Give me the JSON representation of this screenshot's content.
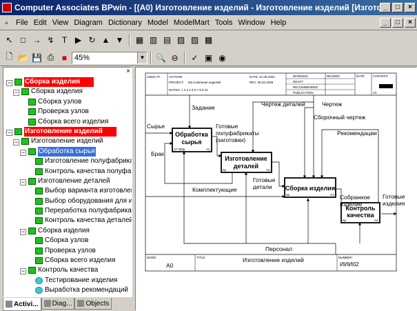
{
  "window": {
    "title": "Computer Associates BPwin - [(A0) Изготовление изделий - Изготовление изделий  [Изготовление изделий]]",
    "min": "_",
    "max": "□",
    "close": "×"
  },
  "menu": [
    "File",
    "Edit",
    "View",
    "Diagram",
    "Dictionary",
    "Model",
    "ModelMart",
    "Tools",
    "Window",
    "Help"
  ],
  "toolbar": {
    "zoom": "45%"
  },
  "tree": [
    {
      "label": "Сборка изделия",
      "level": 0,
      "kind": "red",
      "expander": "−"
    },
    {
      "label": "Сборка изделия",
      "level": 1,
      "expander": "−"
    },
    {
      "label": "Сборка узлов",
      "level": 2
    },
    {
      "label": "Проверка узлов",
      "level": 2
    },
    {
      "label": "Сборка всего изделия",
      "level": 2
    },
    {
      "label": "Изготовление изделий",
      "level": 0,
      "kind": "red",
      "expander": "−"
    },
    {
      "label": "Изготовление изделий",
      "level": 1,
      "expander": "−"
    },
    {
      "label": "Обработка сырья",
      "level": 2,
      "kind": "sel",
      "expander": "−"
    },
    {
      "label": "Изготовление полуфабрикатов",
      "level": 3
    },
    {
      "label": "Контроль качества полуфабрикатов",
      "level": 3
    },
    {
      "label": "Изготовление деталей",
      "level": 2,
      "expander": "−"
    },
    {
      "label": "Выбор  варианта изготовления",
      "level": 3
    },
    {
      "label": "Выбор оборудования для изготовления",
      "level": 3
    },
    {
      "label": "Переработка полуфабрикатов",
      "level": 3
    },
    {
      "label": "Контроль качества деталей",
      "level": 3
    },
    {
      "label": "Сборка изделия",
      "level": 2,
      "expander": "−"
    },
    {
      "label": "Сборка узлов",
      "level": 3
    },
    {
      "label": "Проверка узлов",
      "level": 3
    },
    {
      "label": "Сборка всего изделия",
      "level": 3
    },
    {
      "label": "Контроль качества",
      "level": 2,
      "expander": "−"
    },
    {
      "label": "Тестирование изделия",
      "level": 3,
      "shape": "cyl"
    },
    {
      "label": "Выработка рекомендаций",
      "level": 3,
      "shape": "cyl"
    }
  ],
  "tabs": [
    "Activi...",
    "Diag...",
    "Objects"
  ],
  "diagram": {
    "header": {
      "used_at": "USED AT:",
      "author": "AUTHOR:",
      "project": "PROJECT:",
      "project_name": "Изготовление изделий",
      "notes": "NOTES: 1 2 3 4 5 6 7 8 9 10",
      "date": "DATE: 21.09.2003",
      "rev": "REV: 08.02.2008",
      "working": "WORKING",
      "draft": "DRAFT",
      "recommended": "RECOMMENDED",
      "publication": "PUBLICATION",
      "reader": "READER",
      "date2": "DATE",
      "context": "CONTEXT:",
      "a0": "A0"
    },
    "boxes": [
      {
        "title": "Обработка сырья",
        "cost": "37 000р.",
        "num": "A1"
      },
      {
        "title": "Изготовление деталей",
        "cost": "0р.",
        "num": "A2"
      },
      {
        "title": "Сборка изделия",
        "cost": "0р.",
        "num": "A3"
      },
      {
        "title": "Контроль качества",
        "cost": "0р.",
        "num": "A4"
      }
    ],
    "labels": {
      "zadanie": "Задание",
      "chertezh_detaley": "Чертеж деталей",
      "chertezh": "Чертеж",
      "sborochny": "Сборочный чертеж",
      "rekomendacii": "Рекомендации",
      "syrye": "Сырье",
      "gotovye_pf": "Готовые полуфабрикаты (заготовки)",
      "brak": "Брак",
      "komplekt": "Комплектующие",
      "gotovye_det": "Готовые детали",
      "sobrannoe": "Собранное изделие",
      "gotovye_izd": "Готовые изделия",
      "personal": "Персонал"
    },
    "footer": {
      "node": "NODE:",
      "node_val": "A0",
      "title_lbl": "TITLE:",
      "title_val": "Изготовление изделий",
      "number": "NUMBER:",
      "number_val": "ИИИ02"
    }
  }
}
